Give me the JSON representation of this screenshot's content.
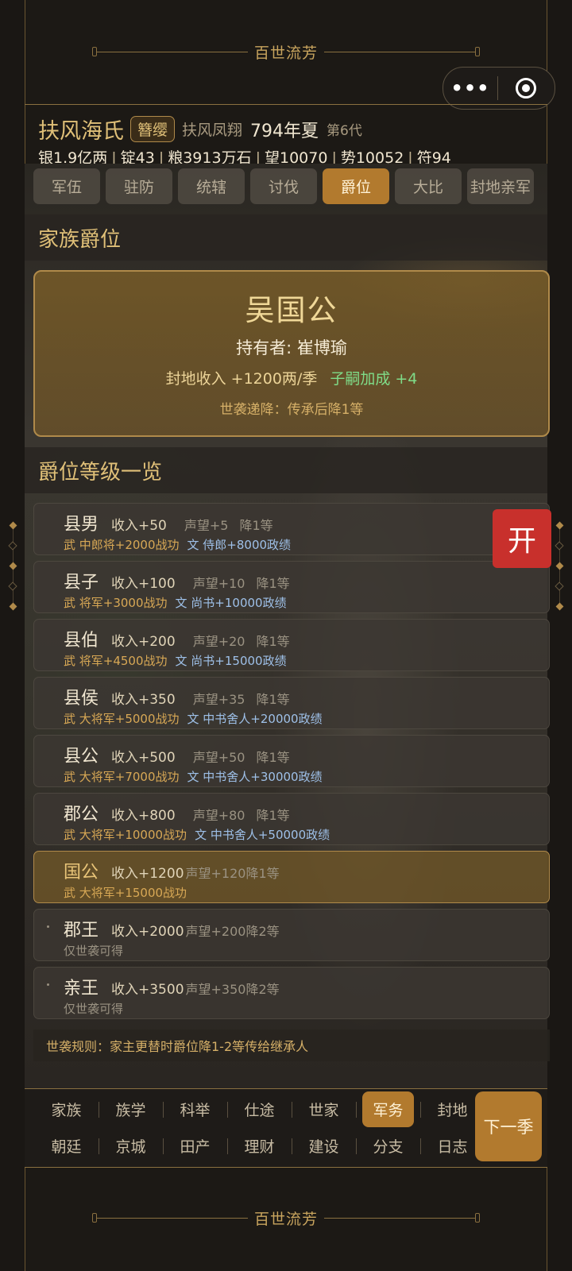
{
  "banner_title": "百世流芳",
  "capsule": {
    "menu_icon": "more-dots-icon",
    "close_icon": "target-close-icon"
  },
  "header": {
    "clan_name": "扶风海氏",
    "badge": "簪缨",
    "clan_sub": "扶风凤翔",
    "date": "794年夏",
    "generation": "第6代",
    "resources": [
      "银1.9亿两",
      "锭43",
      "粮3913万石",
      "望10070",
      "势10052",
      "符94"
    ]
  },
  "tabs": [
    {
      "label": "军伍",
      "active": false
    },
    {
      "label": "驻防",
      "active": false
    },
    {
      "label": "统辖",
      "active": false
    },
    {
      "label": "讨伐",
      "active": false
    },
    {
      "label": "爵位",
      "active": true
    },
    {
      "label": "大比",
      "active": false
    },
    {
      "label": "封地亲军",
      "active": false
    }
  ],
  "family_title": {
    "section_label": "家族爵位",
    "title": "吴国公",
    "holder": "持有者: 崔博瑜",
    "income": "封地收入 +1200两/季",
    "heir_bonus": "子嗣加成 +4",
    "hereditary": "世袭递降：传承后降1等"
  },
  "rank_list": {
    "section_label": "爵位等级一览",
    "rows": [
      {
        "name": "县男",
        "income": "收入+50",
        "reputation": "声望+5",
        "decrease": "降1等",
        "wu": "武 中郎将+2000战功",
        "wen": "文 侍郎+8000政绩",
        "current": false,
        "tight": false
      },
      {
        "name": "县子",
        "income": "收入+100",
        "reputation": "声望+10",
        "decrease": "降1等",
        "wu": "武 将军+3000战功",
        "wen": "文 尚书+10000政绩",
        "current": false,
        "tight": false
      },
      {
        "name": "县伯",
        "income": "收入+200",
        "reputation": "声望+20",
        "decrease": "降1等",
        "wu": "武 将军+4500战功",
        "wen": "文 尚书+15000政绩",
        "current": false,
        "tight": false
      },
      {
        "name": "县侯",
        "income": "收入+350",
        "reputation": "声望+35",
        "decrease": "降1等",
        "wu": "武 大将军+5000战功",
        "wen": "文 中书舍人+20000政绩",
        "current": false,
        "tight": false
      },
      {
        "name": "县公",
        "income": "收入+500",
        "reputation": "声望+50",
        "decrease": "降1等",
        "wu": "武 大将军+7000战功",
        "wen": "文 中书舍人+30000政绩",
        "current": false,
        "tight": false
      },
      {
        "name": "郡公",
        "income": "收入+800",
        "reputation": "声望+80",
        "decrease": "降1等",
        "wu": "武 大将军+10000战功",
        "wen": "文 中书舍人+50000政绩",
        "current": false,
        "tight": false
      },
      {
        "name": "国公",
        "income": "收入+1200",
        "reputation": "声望+120",
        "decrease": "降1等",
        "wu": "武 大将军+15000战功",
        "wen": "",
        "current": true,
        "tight": true
      },
      {
        "name": "郡王",
        "income": "收入+2000",
        "reputation": "声望+200",
        "decrease": "降2等",
        "only": "仅世袭可得",
        "current": false,
        "tight": true,
        "dot": true
      },
      {
        "name": "亲王",
        "income": "收入+3500",
        "reputation": "声望+350",
        "decrease": "降2等",
        "only": "仅世袭可得",
        "current": false,
        "tight": true,
        "dot": true
      }
    ],
    "rule": "世袭规则：家主更替时爵位降1-2等传给继承人"
  },
  "open_button": "开",
  "bottom_nav": {
    "row1": [
      {
        "label": "家族",
        "active": false
      },
      {
        "label": "族学",
        "active": false
      },
      {
        "label": "科举",
        "active": false
      },
      {
        "label": "仕途",
        "active": false
      },
      {
        "label": "世家",
        "active": false
      },
      {
        "label": "军务",
        "active": true
      },
      {
        "label": "封地",
        "active": false
      }
    ],
    "row2": [
      {
        "label": "朝廷",
        "active": false
      },
      {
        "label": "京城",
        "active": false
      },
      {
        "label": "田产",
        "active": false
      },
      {
        "label": "理财",
        "active": false
      },
      {
        "label": "建设",
        "active": false
      },
      {
        "label": "分支",
        "active": false
      },
      {
        "label": "日志",
        "active": false
      }
    ],
    "next_season": "下一季"
  }
}
